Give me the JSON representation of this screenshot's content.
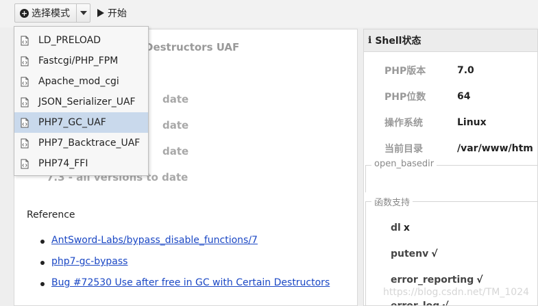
{
  "toolbar": {
    "mode_label": "选择模式",
    "start_label": "开始"
  },
  "main": {
    "heading": "Destructors UAF",
    "version_rows": [
      "date",
      "date",
      "date"
    ],
    "all_versions": "7.3 - all versions to date",
    "reference_title": "Reference",
    "references": [
      "AntSword-Labs/bypass_disable_functions/7",
      "php7-gc-bypass",
      "Bug #72530 Use after free in GC with Certain Destructors"
    ]
  },
  "dropdown": {
    "items": [
      "LD_PRELOAD",
      "Fastcgi/PHP_FPM",
      "Apache_mod_cgi",
      "JSON_Serializer_UAF",
      "PHP7_GC_UAF",
      "PHP7_Backtrace_UAF",
      "PHP74_FFI"
    ],
    "selected": "PHP7_GC_UAF",
    "item_icon": "file-code-icon"
  },
  "shell": {
    "title": "Shell状态",
    "info": [
      {
        "key": "PHP版本",
        "value": "7.0"
      },
      {
        "key": "PHP位数",
        "value": "64"
      },
      {
        "key": "操作系统",
        "value": "Linux"
      },
      {
        "key": "当前目录",
        "value": "/var/www/htm"
      }
    ],
    "open_basedir_legend": "open_basedir",
    "functions_legend": "函数支持",
    "functions": [
      {
        "name": "dl",
        "mark": "x"
      },
      {
        "name": "putenv",
        "mark": "√"
      },
      {
        "name": "error_reporting",
        "mark": "√"
      },
      {
        "name": "error_log",
        "mark": "√"
      }
    ]
  },
  "watermark": "https://blog.csdn.net/TM_1024",
  "colors": {
    "link": "#1a47c4",
    "selected_bg": "#c9d9ec"
  }
}
